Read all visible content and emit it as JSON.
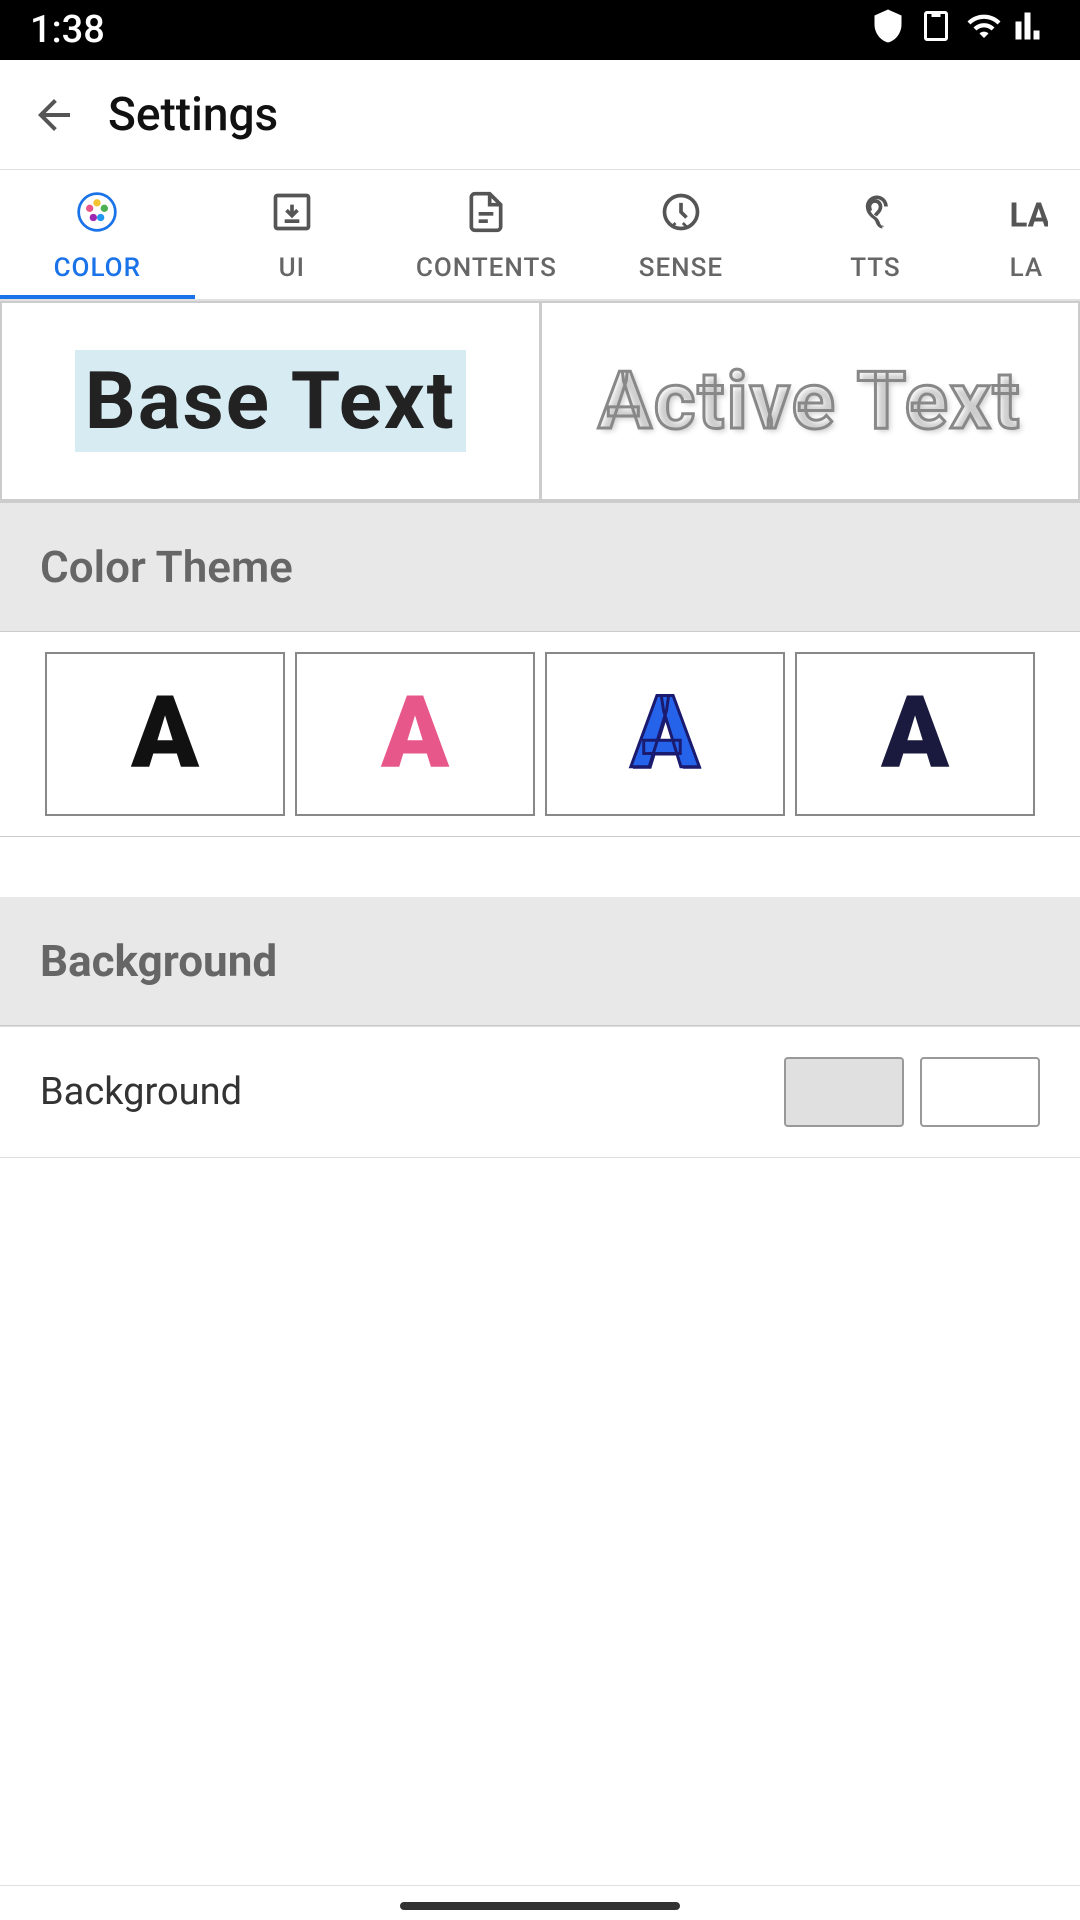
{
  "status_bar": {
    "time": "1:38",
    "icons": [
      "shield",
      "clipboard",
      "wifi",
      "signal"
    ]
  },
  "header": {
    "back_label": "←",
    "title": "Settings"
  },
  "tabs": [
    {
      "id": "color",
      "label": "COLOR",
      "icon": "palette",
      "active": true
    },
    {
      "id": "ui",
      "label": "UI",
      "icon": "download-box"
    },
    {
      "id": "contents",
      "label": "CONTENTS",
      "icon": "document"
    },
    {
      "id": "sense",
      "label": "SENSE",
      "icon": "clock-down"
    },
    {
      "id": "tts",
      "label": "TTS",
      "icon": "hearing"
    },
    {
      "id": "la",
      "label": "LA",
      "icon": "la"
    }
  ],
  "text_preview": {
    "base_text": "Base Text",
    "active_text": "Active Text"
  },
  "color_theme": {
    "title": "Color Theme",
    "options": [
      {
        "letter": "A",
        "style": "black"
      },
      {
        "letter": "A",
        "style": "pink"
      },
      {
        "letter": "A",
        "style": "blue"
      },
      {
        "letter": "A",
        "style": "dark"
      }
    ]
  },
  "background_section": {
    "title": "Background",
    "row_label": "Background",
    "swatches": [
      "gray",
      "white"
    ]
  }
}
